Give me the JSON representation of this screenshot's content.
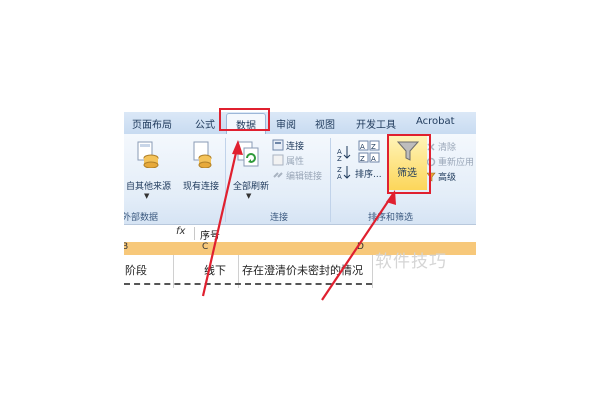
{
  "tabs": [
    "页面布局",
    "公式",
    "数据",
    "审阅",
    "视图",
    "开发工具",
    "Acrobat"
  ],
  "ribbon": {
    "groups": [
      {
        "label": "外部数据",
        "buttons": [
          "自其他来源",
          "现有连接"
        ]
      },
      {
        "label": "连接",
        "buttons": [
          "全部刷新",
          "连接",
          "属性",
          "编辑链接"
        ]
      },
      {
        "label": "排序和筛选",
        "buttons": [
          "排序...",
          "筛选",
          "清除",
          "重新应用",
          "高级"
        ]
      }
    ]
  },
  "formula_bar": {
    "fx": "fx",
    "content": "序号"
  },
  "columns": [
    "B",
    "C",
    "D"
  ],
  "row": {
    "b": "阶段",
    "c": "线下",
    "d": "存在澄清价未密封的情况"
  },
  "watermark": "软件技巧",
  "highlight_color": "#e0202f"
}
